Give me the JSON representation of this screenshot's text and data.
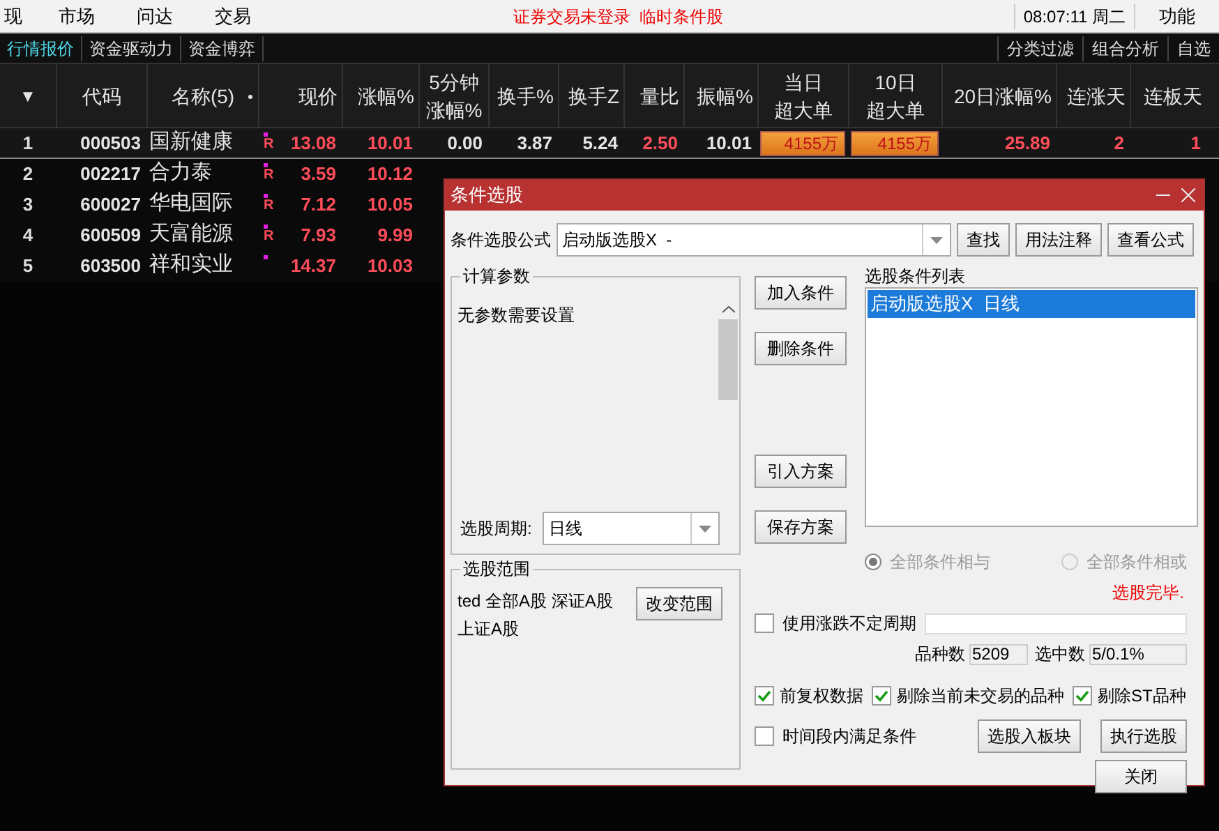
{
  "menu": {
    "items": [
      "现",
      "市场",
      "问达",
      "交易"
    ],
    "notice": "证券交易未登录  临时条件股",
    "clock": "08:07:11 周二",
    "function": "功能"
  },
  "tabs": [
    {
      "label": "行情报价",
      "selected": true
    },
    {
      "label": "资金驱动力",
      "selected": false
    },
    {
      "label": "资金博弈",
      "selected": false
    }
  ],
  "right_tabs": [
    "分类过滤",
    "组合分析",
    "自选"
  ],
  "table": {
    "sort_marker": "▼",
    "columns": [
      {
        "lines": [
          "代码"
        ]
      },
      {
        "lines": [
          "名称(5)"
        ]
      },
      {
        "lines": [
          "现价"
        ]
      },
      {
        "lines": [
          "涨幅%"
        ]
      },
      {
        "lines": [
          "5分钟",
          "涨幅%"
        ]
      },
      {
        "lines": [
          "换手%"
        ]
      },
      {
        "lines": [
          "换手Z"
        ]
      },
      {
        "lines": [
          "量比"
        ]
      },
      {
        "lines": [
          "振幅%"
        ]
      },
      {
        "lines": [
          "当日",
          "超大单"
        ]
      },
      {
        "lines": [
          "10日",
          "超大单"
        ]
      },
      {
        "lines": [
          "20日涨幅%"
        ]
      },
      {
        "lines": [
          "连涨天"
        ]
      },
      {
        "lines": [
          "连板天"
        ]
      }
    ],
    "rows": [
      {
        "index": "1",
        "selected": true,
        "badge": "R",
        "cells": [
          {
            "text": "000503",
            "kind": "code"
          },
          {
            "text": "国新健康",
            "kind": "name"
          },
          {
            "text": "13.08",
            "kind": "up"
          },
          {
            "text": "10.01",
            "kind": "up"
          },
          {
            "text": "0.00",
            "kind": "flat"
          },
          {
            "text": "3.87",
            "kind": "flat"
          },
          {
            "text": "5.24",
            "kind": "flat"
          },
          {
            "text": "2.50",
            "kind": "up"
          },
          {
            "text": "10.01",
            "kind": "flat"
          },
          {
            "text": "4155万",
            "kind": "bar"
          },
          {
            "text": "4155万",
            "kind": "bar"
          },
          {
            "text": "25.89",
            "kind": "up"
          },
          {
            "text": "2",
            "kind": "up"
          },
          {
            "text": "1",
            "kind": "up"
          }
        ]
      },
      {
        "index": "2",
        "selected": false,
        "badge": "R",
        "cells": [
          {
            "text": "002217",
            "kind": "code"
          },
          {
            "text": "合力泰",
            "kind": "name"
          },
          {
            "text": "3.59",
            "kind": "up"
          },
          {
            "text": "10.12",
            "kind": "up"
          }
        ]
      },
      {
        "index": "3",
        "selected": false,
        "badge": "R",
        "cells": [
          {
            "text": "600027",
            "kind": "code"
          },
          {
            "text": "华电国际",
            "kind": "name"
          },
          {
            "text": "7.12",
            "kind": "up"
          },
          {
            "text": "10.05",
            "kind": "up"
          }
        ]
      },
      {
        "index": "4",
        "selected": false,
        "badge": "R",
        "cells": [
          {
            "text": "600509",
            "kind": "code"
          },
          {
            "text": "天富能源",
            "kind": "name"
          },
          {
            "text": "7.93",
            "kind": "up"
          },
          {
            "text": "9.99",
            "kind": "up"
          }
        ]
      },
      {
        "index": "5",
        "selected": false,
        "cells": [
          {
            "text": "603500",
            "kind": "code"
          },
          {
            "text": "祥和实业",
            "kind": "name"
          },
          {
            "text": "14.37",
            "kind": "up"
          },
          {
            "text": "10.03",
            "kind": "up"
          }
        ]
      }
    ]
  },
  "dialog": {
    "title": "条件选股",
    "formula_label": "条件选股公式",
    "formula_value": "启动版选股X  -",
    "top_buttons": [
      "查找",
      "用法注释",
      "查看公式"
    ],
    "params_title": "计算参数",
    "params_text": "无参数需要设置",
    "period_label": "选股周期:",
    "period_value": "日线",
    "middle_buttons": [
      "加入条件",
      "删除条件",
      "引入方案",
      "保存方案"
    ],
    "list_title": "选股条件列表",
    "list_items": [
      {
        "label": "启动版选股X  日线",
        "selected": true
      }
    ],
    "radios": [
      {
        "label": "全部条件相与",
        "selected": true
      },
      {
        "label": "全部条件相或",
        "selected": false
      }
    ],
    "status": "选股完毕.",
    "range_title": "选股范围",
    "range_lines": [
      "ted 全部A股 深证A股",
      "上证A股"
    ],
    "range_button": "改变范围",
    "variable_period": {
      "label": "使用涨跌不定周期",
      "checked": false
    },
    "count_label": "品种数",
    "count_value": "5209",
    "selected_label": "选中数",
    "selected_value": "5/0.1%",
    "options": [
      {
        "label": "前复权数据",
        "checked": true
      },
      {
        "label": "剔除当前未交易的品种",
        "checked": true
      },
      {
        "label": "剔除ST品种",
        "checked": true
      }
    ],
    "time_option": {
      "label": "时间段内满足条件",
      "checked": false
    },
    "bottom_buttons": [
      "选股入板块",
      "执行选股",
      "关闭"
    ]
  }
}
